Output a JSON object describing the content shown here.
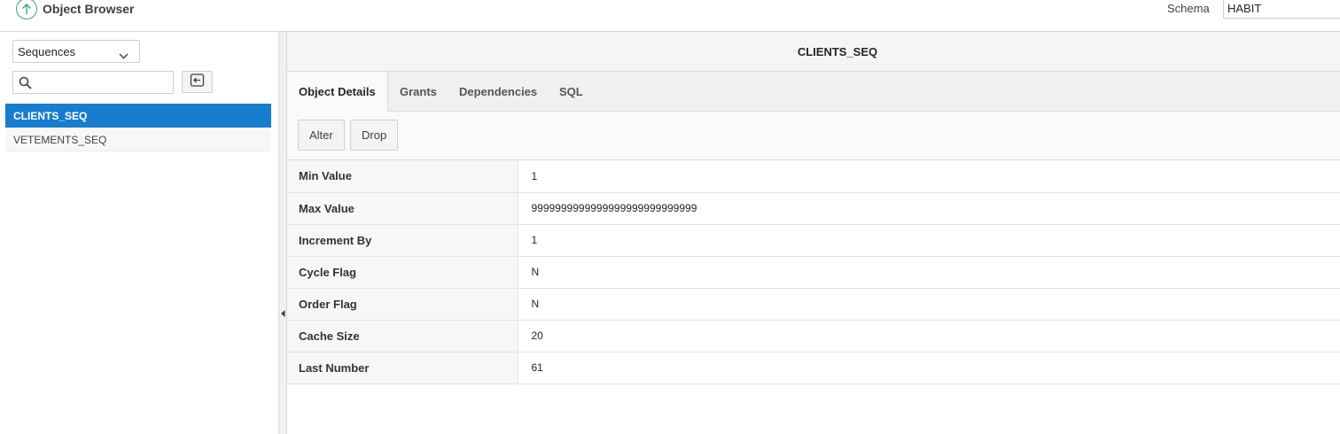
{
  "header": {
    "title": "Object Browser",
    "schema_label": "Schema",
    "schema_value": "HABIT"
  },
  "left": {
    "object_type": "Sequences",
    "search_placeholder": "",
    "items": [
      {
        "label": "CLIENTS_SEQ",
        "selected": true
      },
      {
        "label": "VETEMENTS_SEQ",
        "selected": false
      }
    ]
  },
  "main": {
    "object_name": "CLIENTS_SEQ",
    "tabs": [
      {
        "label": "Object Details",
        "active": true
      },
      {
        "label": "Grants",
        "active": false
      },
      {
        "label": "Dependencies",
        "active": false
      },
      {
        "label": "SQL",
        "active": false
      }
    ],
    "actions": {
      "alter_label": "Alter",
      "drop_label": "Drop"
    },
    "details": [
      {
        "label": "Min Value",
        "value": "1"
      },
      {
        "label": "Max Value",
        "value": "9999999999999999999999999999"
      },
      {
        "label": "Increment By",
        "value": "1"
      },
      {
        "label": "Cycle Flag",
        "value": "N"
      },
      {
        "label": "Order Flag",
        "value": "N"
      },
      {
        "label": "Cache Size",
        "value": "20"
      },
      {
        "label": "Last Number",
        "value": "61"
      }
    ]
  },
  "colors": {
    "accent": "#1a7ccc",
    "up_icon": "#3aa675"
  },
  "icons": {
    "up": "arrow-up-circle-icon",
    "chevron": "chevron-down-icon",
    "search": "search-icon",
    "reset": "reset-icon",
    "collapse": "collapse-left-icon"
  }
}
